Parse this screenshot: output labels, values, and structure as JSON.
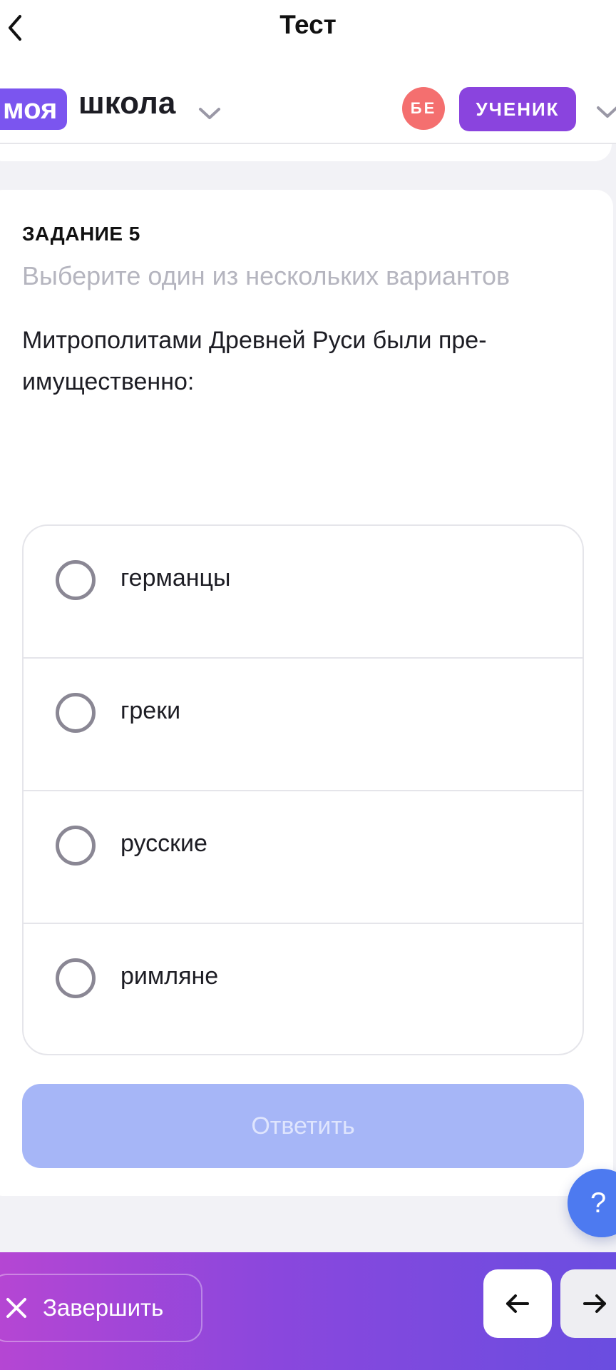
{
  "nav": {
    "title": "Тест",
    "back_icon": "chevron-left-icon"
  },
  "school": {
    "logo_badge": "моя",
    "logo_text": "школа",
    "avatar_initials": "БЕ",
    "role": "УЧЕНИК"
  },
  "task": {
    "label": "ЗАДАНИЕ 5",
    "hint": "Выберите один из нескольких вариантов",
    "question_line1": "Митрополитами Древней Руси были пре-",
    "question_line2": "имущественно:",
    "options": [
      {
        "label": "германцы",
        "selected": false
      },
      {
        "label": "греки",
        "selected": false
      },
      {
        "label": "русские",
        "selected": false
      },
      {
        "label": "римляне",
        "selected": false
      }
    ],
    "submit_label": "Ответить"
  },
  "help": {
    "label": "?"
  },
  "bottom": {
    "finish_label": "Завершить",
    "prev_icon": "arrow-left-icon",
    "next_icon": "arrow-right-icon"
  },
  "colors": {
    "brand_purple": "#7b55ef",
    "role_purple": "#8a44de",
    "avatar_red": "#f46f6f",
    "submit_disabled": "#a6b6f7",
    "help_blue": "#4d7af0"
  }
}
